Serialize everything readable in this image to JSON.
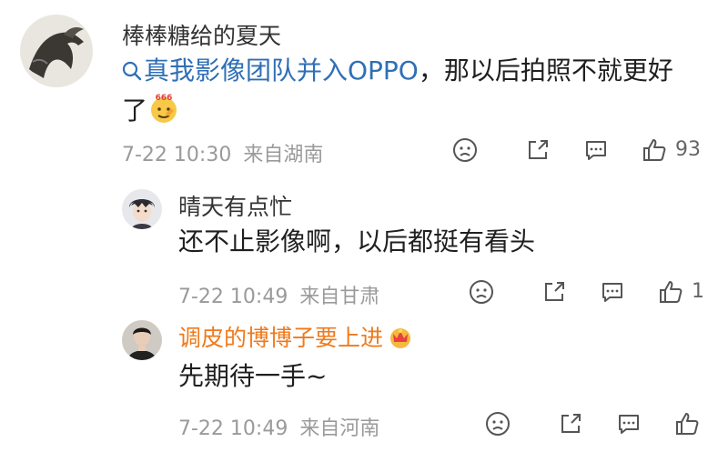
{
  "comment": {
    "username": "棒棒糖给的夏天",
    "topic": "真我影像团队并入OPPO",
    "text_line1_rest": "，那以后拍照不就更好",
    "text_line2": "了",
    "time": "7-22 10:30",
    "source": "来自湖南",
    "like_count": "93"
  },
  "replies": [
    {
      "username": "晴天有点忙",
      "text": "还不止影像啊，以后都挺有看头",
      "time": "7-22 10:49",
      "source": "来自甘肃",
      "like_count": "1"
    },
    {
      "username": "调皮的博博子要上进",
      "text": "先期待一手~",
      "time": "7-22 10:49",
      "source": "来自河南",
      "like_count": ""
    }
  ],
  "colors": {
    "topic": "#2f6fb6",
    "orange_username": "#ef7a1c",
    "meta": "#9a9a9a"
  },
  "icons": [
    "search-icon",
    "emoji-666-icon",
    "crown-badge-icon",
    "dislike-face-icon",
    "share-icon",
    "comment-icon",
    "like-icon"
  ]
}
